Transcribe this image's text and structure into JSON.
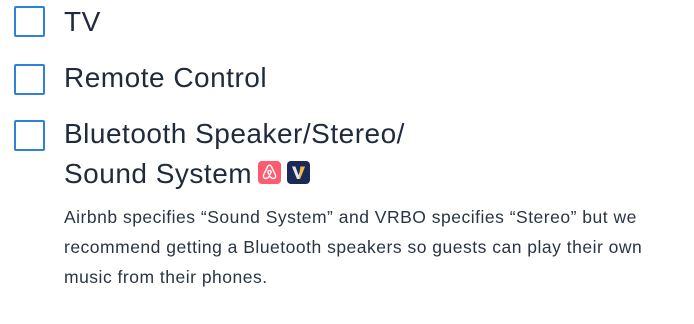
{
  "checklist": {
    "items": [
      {
        "label": "TV"
      },
      {
        "label": "Remote Control"
      },
      {
        "label_line1": "Bluetooth Speaker/Stereo/",
        "label_line2": "Sound System"
      }
    ],
    "icons": {
      "airbnb": "airbnb-logo-icon",
      "vrbo": "vrbo-logo-icon"
    },
    "note": "Airbnb specifies “Sound System” and VRBO specifies “Stereo” but we recommend getting a Bluetooth speakers so guests can play their own music from their phones."
  },
  "colors": {
    "checkbox_border": "#2f80d8",
    "text": "#1f2a3a",
    "airbnb": "#ff5a6e",
    "vrbo": "#1b2a55"
  }
}
